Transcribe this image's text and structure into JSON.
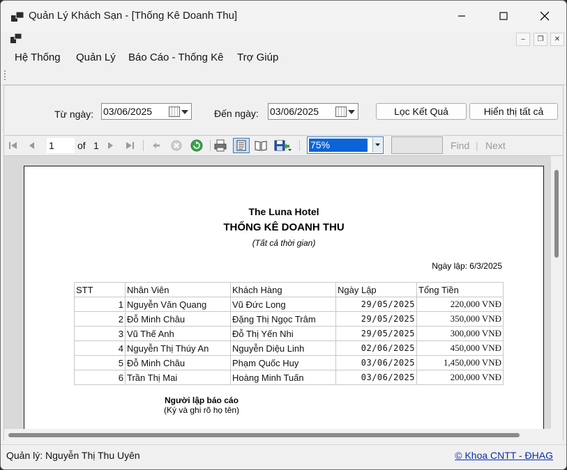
{
  "window": {
    "title": "Quản Lý Khách Sạn - [Thống Kê Doanh Thu]"
  },
  "menu": [
    "Hệ Thống",
    "Quản Lý",
    "Báo Cáo - Thống Kê",
    "Trợ Giúp"
  ],
  "filter": {
    "from_label": "Từ ngày:",
    "from_value": "03/06/2025",
    "to_label": "Đến ngày:",
    "to_value": "03/06/2025",
    "filter_button": "Lọc Kết Quả",
    "show_all_button": "Hiển thị tất cả"
  },
  "viewer_toolbar": {
    "page_current": "1",
    "of_label": "of",
    "page_total": "1",
    "zoom": "75%",
    "find_label": "Find",
    "separator": "|",
    "next_label": "Next"
  },
  "report": {
    "hotel": "The Luna Hotel",
    "title": "THỐNG KÊ DOANH THU",
    "subtitle": "(Tất cả thời gian)",
    "date_label": "Ngày lập: 6/3/2025",
    "columns": [
      "STT",
      "Nhân Viên",
      "Khách Hàng",
      "Ngày Lập",
      "Tổng Tiền"
    ],
    "rows": [
      [
        "1",
        "Nguyễn Văn Quang",
        "Vũ Đức Long",
        "29/05/2025",
        "220,000 VNĐ"
      ],
      [
        "2",
        "Đỗ Minh Châu",
        "Đặng Thị Ngọc Trâm",
        "29/05/2025",
        "350,000 VNĐ"
      ],
      [
        "3",
        "Vũ Thế Anh",
        "Đỗ Thị Yến Nhi",
        "29/05/2025",
        "300,000 VNĐ"
      ],
      [
        "4",
        "Nguyễn Thị Thúy An",
        "Nguyễn Diệu Linh",
        "02/06/2025",
        "450,000 VNĐ"
      ],
      [
        "5",
        "Đỗ Minh Châu",
        "Phạm Quốc Huy",
        "03/06/2025",
        "1,450,000 VNĐ"
      ],
      [
        "6",
        "Trần Thị Mai",
        "Hoàng Minh Tuấn",
        "03/06/2025",
        "200,000 VNĐ"
      ]
    ],
    "signer": "Người lập báo cáo",
    "signer_note": "(Ký và ghi rõ họ tên)"
  },
  "status": {
    "manager": "Quản lý: Nguyễn Thị Thu Uyên",
    "credit": "© Khoa CNTT - ĐHAG"
  },
  "icons": [
    "app-icon",
    "minimize-icon",
    "maximize-icon",
    "close-icon",
    "first-page-icon",
    "prev-page-icon",
    "next-page-icon",
    "last-page-icon",
    "back-icon",
    "stop-icon",
    "refresh-icon",
    "print-icon",
    "print-layout-icon",
    "page-setup-icon",
    "export-icon",
    "calendar-icon"
  ]
}
